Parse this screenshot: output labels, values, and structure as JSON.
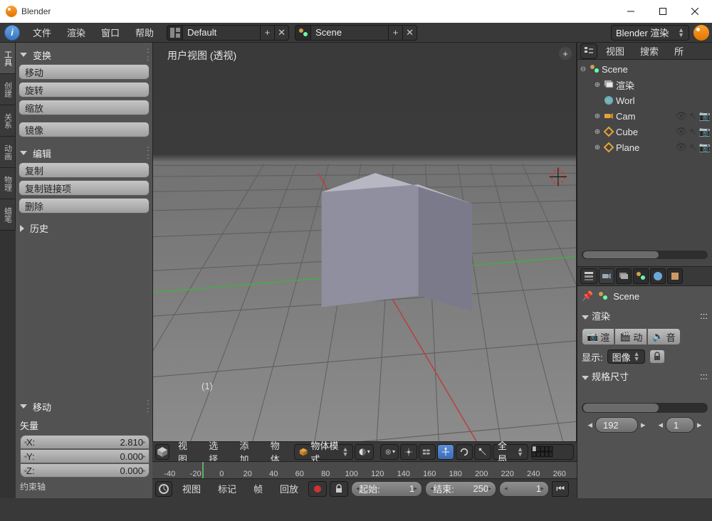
{
  "app": {
    "title": "Blender"
  },
  "topmenu": {
    "file": "文件",
    "render": "渲染",
    "window": "窗口",
    "help": "帮助",
    "layout": "Default",
    "scene": "Scene",
    "engine": "Blender 渲染"
  },
  "vtabs": [
    "工具",
    "创建",
    "关系",
    "动画",
    "物理",
    "蜡笔"
  ],
  "tool_panel": {
    "transform_header": "变换",
    "move": "移动",
    "rotate": "旋转",
    "scale": "缩放",
    "mirror": "镜像",
    "edit_header": "编辑",
    "dup": "复制",
    "dup_link": "复制链接项",
    "delete": "删除",
    "history": "历史",
    "move_header": "移动",
    "vector_label": "矢量",
    "vec": [
      {
        "axis": "X:",
        "val": "2.810"
      },
      {
        "axis": "Y:",
        "val": "0.000"
      },
      {
        "axis": "Z:",
        "val": "0.000"
      }
    ],
    "constraint": "约束轴"
  },
  "viewport": {
    "label": "用户视图  (透视)",
    "overlay_num": "(1)"
  },
  "vp_header": {
    "view": "视图",
    "select": "选择",
    "add": "添加",
    "object": "物体",
    "mode": "物体模式",
    "orient": "全局"
  },
  "timeline": {
    "ticks": [
      "-40",
      "-20",
      "0",
      "20",
      "40",
      "60",
      "80",
      "100",
      "120",
      "140",
      "160",
      "180",
      "200",
      "220",
      "240",
      "260"
    ],
    "view": "视图",
    "marker": "标记",
    "frame": "帧",
    "playback": "回放",
    "start_label": "起始:",
    "start": "1",
    "end_label": "结束:",
    "end": "250",
    "cur": "1"
  },
  "outliner": {
    "menu_view": "视图",
    "menu_search": "搜索",
    "menu_all": "所",
    "root": "Scene",
    "items": [
      {
        "name": "渲染",
        "icon": "layers"
      },
      {
        "name": "Worl",
        "icon": "world"
      },
      {
        "name": "Cam",
        "icon": "camera",
        "vis": true
      },
      {
        "name": "Cube",
        "icon": "mesh",
        "vis": true
      },
      {
        "name": "Plane",
        "icon": "mesh",
        "vis": true
      }
    ]
  },
  "props": {
    "scene": "Scene",
    "render_header": "渲染",
    "tabs": [
      {
        "l": "渲",
        "i": "cam"
      },
      {
        "l": "动",
        "i": "clap"
      },
      {
        "l": "音",
        "i": "aud"
      }
    ],
    "show_label": "显示:",
    "show_value": "图像",
    "dims_header": "规格尺寸",
    "page": "192",
    "page2": "1"
  }
}
